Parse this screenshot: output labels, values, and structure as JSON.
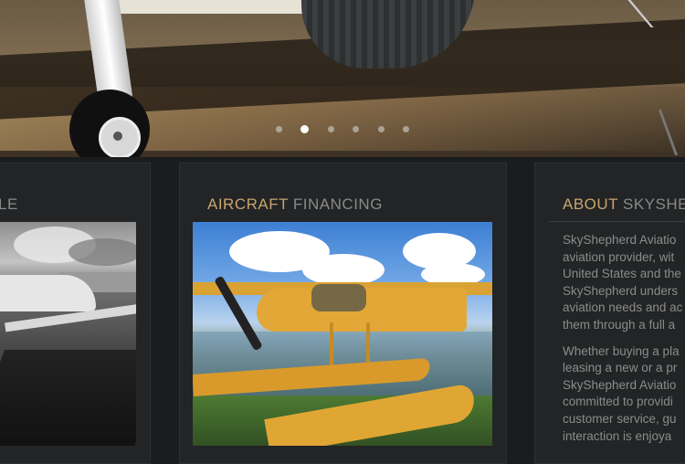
{
  "hero": {
    "slider_dots": [
      {
        "active": false
      },
      {
        "active": true
      },
      {
        "active": false
      },
      {
        "active": false
      },
      {
        "active": false
      },
      {
        "active": false
      }
    ]
  },
  "cards": [
    {
      "title_accent": "",
      "title_rest": "LE"
    },
    {
      "title_accent": "AIRCRAFT",
      "title_rest": " FINANCING"
    },
    {
      "title_accent": "ABOUT",
      "title_rest": " SKYSHE"
    }
  ],
  "about": {
    "paragraph1": [
      "SkyShepherd Aviatio",
      "aviation provider, wit",
      "United States and the",
      "SkyShepherd unders",
      "aviation needs and ac",
      "them through a full a"
    ],
    "paragraph2": [
      "Whether buying a pla",
      "leasing a new or a pr",
      "SkyShepherd Aviatio",
      "committed to providi",
      "customer service, gu",
      "interaction is enjoya"
    ]
  },
  "colors": {
    "accent": "#c9a46c",
    "text_muted": "#8c8c8c",
    "background": "#1b1c1d",
    "card": "#222425"
  }
}
